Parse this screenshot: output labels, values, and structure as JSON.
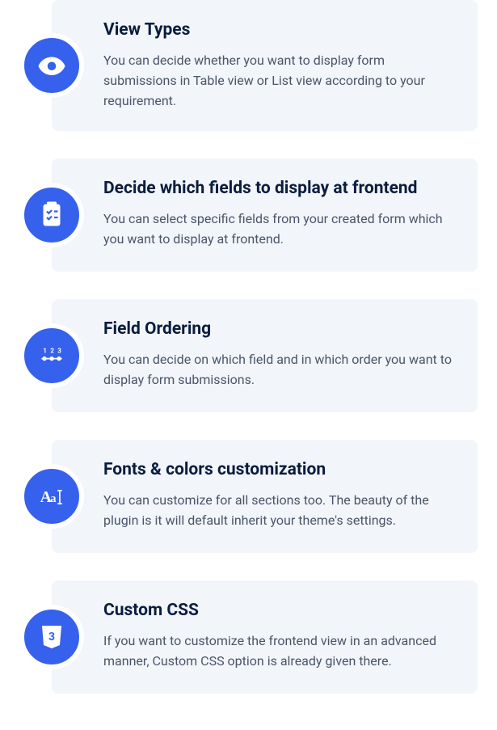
{
  "accent_color": "#3661ed",
  "features": [
    {
      "icon": "eye-icon",
      "title": "View Types",
      "description": "You can decide whether you want to display form submissions in Table view or List view according to your requirement."
    },
    {
      "icon": "clipboard-icon",
      "title": "Decide which fields to display at frontend",
      "description": "You can select specific fields from your created form which you want to display at frontend."
    },
    {
      "icon": "ordering-icon",
      "title": "Field Ordering",
      "description": "You can decide on which field and in which order you want to display form submissions."
    },
    {
      "icon": "fonts-icon",
      "title": "Fonts & colors customization",
      "description": "You can customize for all sections too. The beauty of the plugin is it will default inherit your theme's settings."
    },
    {
      "icon": "css-icon",
      "title": "Custom CSS",
      "description": "If you want to customize the frontend view in an advanced manner, Custom CSS option is already given there."
    }
  ]
}
